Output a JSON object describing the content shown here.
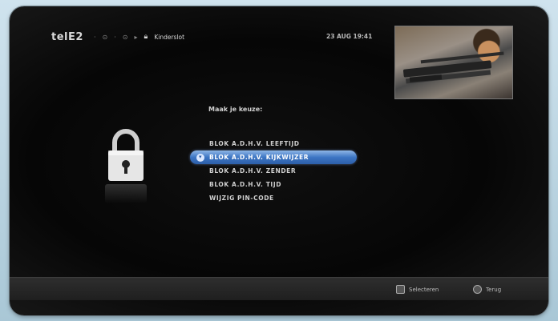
{
  "header": {
    "logo": "telE2",
    "crumbs": [
      "·",
      "⊙",
      "·",
      "⊙",
      "▸"
    ],
    "section": "Kinderslot",
    "datetime": "23 AUG 19:41"
  },
  "menu": {
    "title": "Maak je keuze:",
    "items": [
      {
        "label": "BLOK A.D.H.V. LEEFTIJD",
        "selected": false
      },
      {
        "label": "BLOK A.D.H.V. KIJKWIJZER",
        "selected": true
      },
      {
        "label": "BLOK A.D.H.V. ZENDER",
        "selected": false
      },
      {
        "label": "BLOK A.D.H.V. TIJD",
        "selected": false
      },
      {
        "label": "WIJZIG PIN-CODE",
        "selected": false
      }
    ]
  },
  "footer": {
    "navigate_label": "Selecteren",
    "back_label": "Terug"
  },
  "icons": {
    "lock": "padlock-icon",
    "navigate": "select-icon",
    "back": "back-icon"
  },
  "colors": {
    "selection": "#3d76c4",
    "background": "#060606"
  }
}
